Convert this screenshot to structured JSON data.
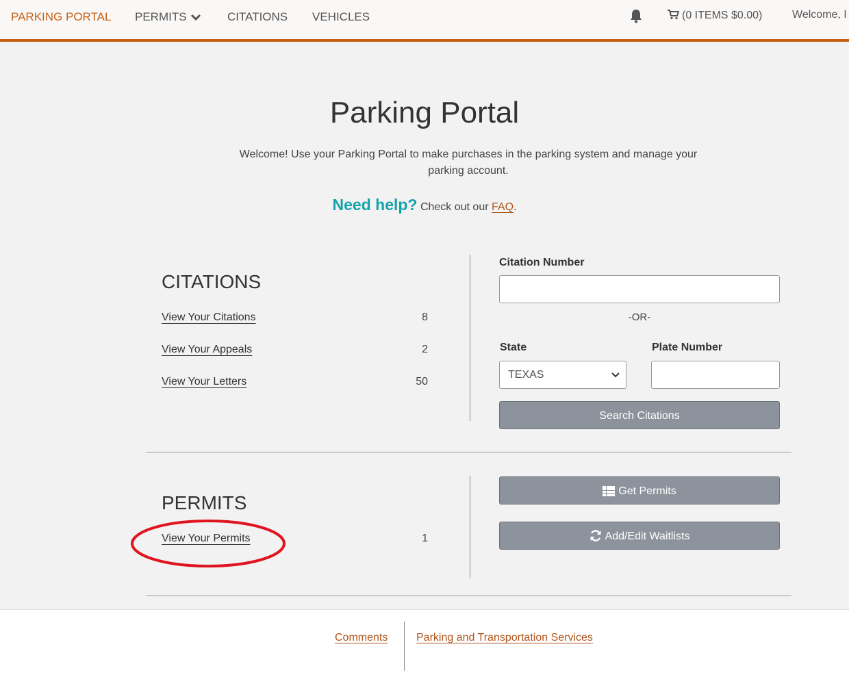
{
  "nav": {
    "brand": "PARKING PORTAL",
    "permits": "PERMITS",
    "citations": "CITATIONS",
    "vehicles": "VEHICLES",
    "cart": "(0 ITEMS $0.00)",
    "welcome": "Welcome, I"
  },
  "hero": {
    "title": "Parking Portal",
    "intro": "Welcome! Use your Parking Portal to make purchases in the parking system and manage your parking account.",
    "help_heading": "Need help?",
    "help_text": "Check out our",
    "faq": "FAQ",
    "period": "."
  },
  "citations": {
    "title": "CITATIONS",
    "rows": [
      {
        "label": "View Your Citations",
        "count": "8"
      },
      {
        "label": "View Your Appeals",
        "count": "2"
      },
      {
        "label": "View Your Letters",
        "count": "50"
      }
    ],
    "search": {
      "citation_label": "Citation Number",
      "or": "-OR-",
      "state_label": "State",
      "state_value": "TEXAS",
      "plate_label": "Plate Number",
      "button": "Search Citations"
    }
  },
  "permits": {
    "title": "PERMITS",
    "rows": [
      {
        "label": "View Your Permits",
        "count": "1"
      }
    ],
    "get_button": "Get Permits",
    "waitlist_button": "Add/Edit Waitlists"
  },
  "footer": {
    "comments": "Comments",
    "pts": "Parking and Transportation Services"
  },
  "colors": {
    "accent": "#c55f12",
    "help": "#16a3ab",
    "button": "#8d939c",
    "annotation": "#e0141e"
  }
}
